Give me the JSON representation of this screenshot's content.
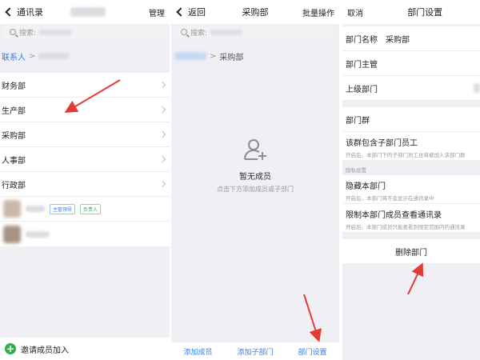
{
  "panel1": {
    "back_label": "通讯录",
    "manage_label": "管理",
    "search_placeholder": "搜索:",
    "breadcrumb_root": "联系人",
    "breadcrumb_sep": ">",
    "departments": [
      {
        "label": "财务部"
      },
      {
        "label": "生产部"
      },
      {
        "label": "采购部"
      },
      {
        "label": "人事部"
      },
      {
        "label": "行政部"
      }
    ],
    "member_tags": [
      "主管领导",
      "负责人"
    ],
    "invite_label": "邀请成员加入",
    "invite_icon": "plus-circle-icon"
  },
  "panel2": {
    "back_label": "返回",
    "title": "采购部",
    "batch_label": "批量操作",
    "search_placeholder": "搜索:",
    "breadcrumb_sep": ">",
    "breadcrumb_current": "采购部",
    "empty_title": "暂无成员",
    "empty_subtitle": "点击下方添加成员或子部门",
    "empty_icon": "add-person-icon",
    "bottom_actions": [
      "添加成员",
      "添加子部门",
      "部门设置"
    ]
  },
  "panel3": {
    "cancel_label": "取消",
    "title": "部门设置",
    "dept_name_label": "部门名称",
    "dept_name_value": "采购部",
    "dept_head_label": "部门主管",
    "parent_dept_label": "上级部门",
    "dept_group_label": "部门群",
    "include_sub_title": "该群包含子部门员工",
    "include_sub_desc": "开启后，本部门下的子部门员工也将被加入该部门群",
    "privacy_section": "隐私设置",
    "hide_dept_title": "隐藏本部门",
    "hide_dept_desc": "开启后，本部门将不会显示在通讯录中",
    "restrict_title": "限制本部门成员查看通讯录",
    "restrict_desc": "开启后，本部门成员只能查看到限定范围内的通讯录",
    "delete_label": "删除部门"
  },
  "colors": {
    "accent_blue": "#2d7ef5",
    "invite_green": "#2bb24c",
    "annotation_red": "#e53935",
    "background_gray": "#efeff4"
  }
}
